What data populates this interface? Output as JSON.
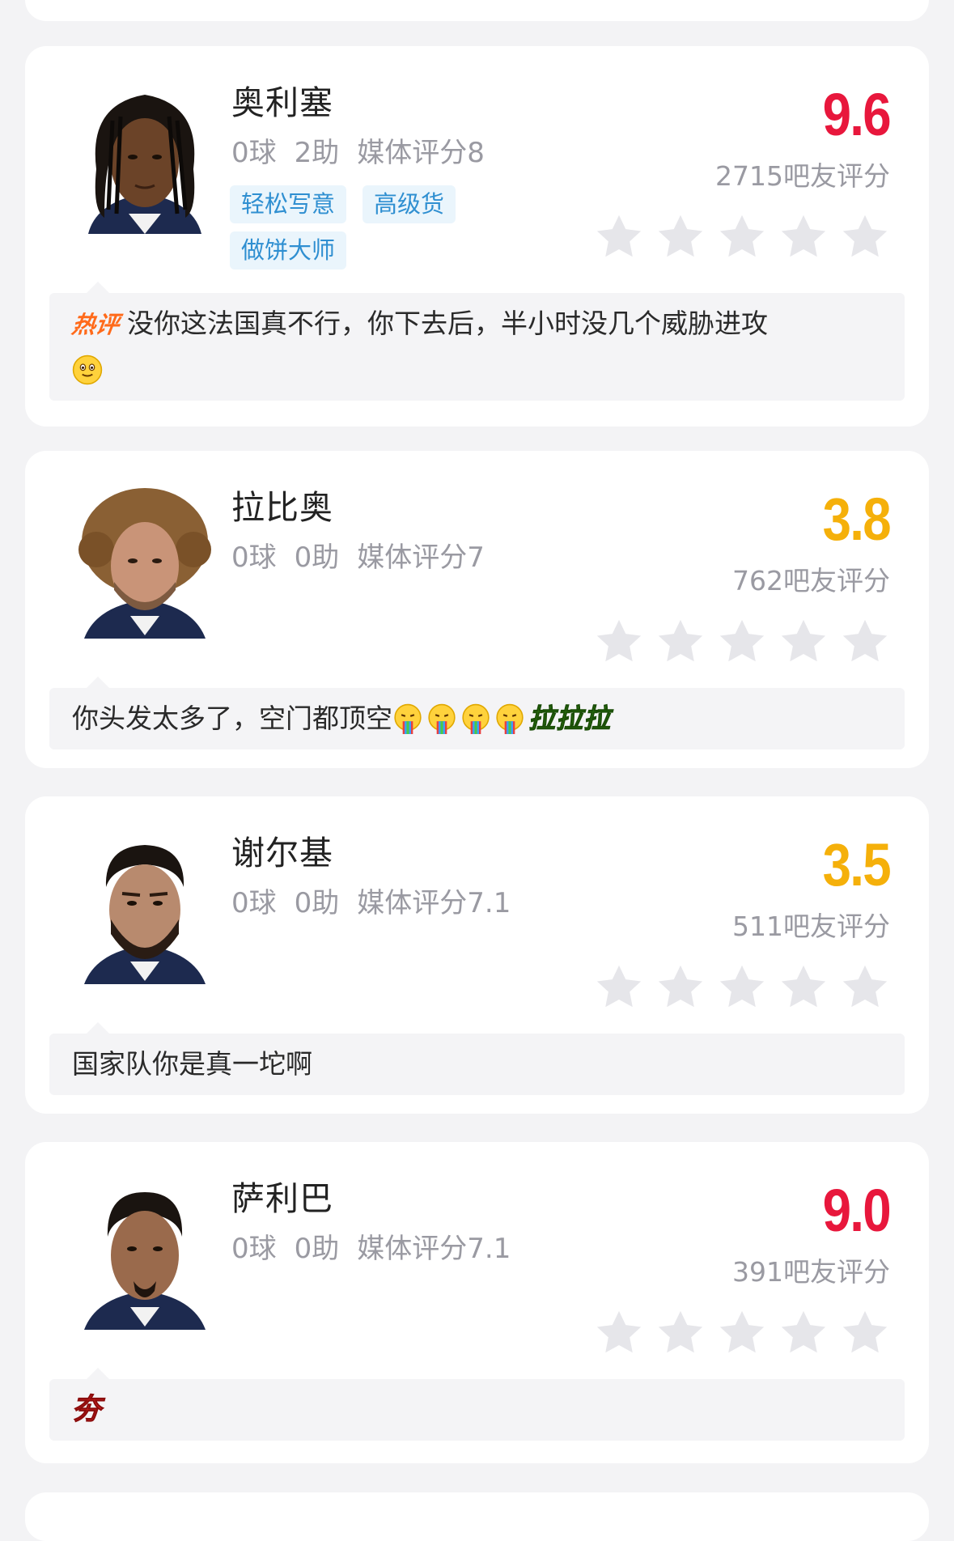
{
  "colors": {
    "score_high": "#e8173c",
    "score_low": "#f5b00a",
    "tag_bg": "#eaf5fc",
    "tag_text": "#2f8fd1",
    "star_empty": "#e6e6ea",
    "page_bg": "#f3f3f5"
  },
  "players": [
    {
      "name": "奥利塞",
      "goals": "0球",
      "assists": "2助",
      "media": "媒体评分8",
      "tags": [
        "轻松写意",
        "高级货",
        "做饼大师"
      ],
      "score": "9.6",
      "score_color": "red",
      "raters": "2715吧友评分",
      "stars_filled": 0,
      "comment": {
        "badge": "热评",
        "text": "没你这法国真不行，你下去后，半小时没几个威胁进攻",
        "emoji": "smile-emoji"
      }
    },
    {
      "name": "拉比奥",
      "goals": "0球",
      "assists": "0助",
      "media": "媒体评分7",
      "tags": [],
      "score": "3.8",
      "score_color": "gold",
      "raters": "762吧友评分",
      "stars_filled": 0,
      "comment": {
        "text": "你头发太多了，空门都顶空",
        "emoji": "rainbow-vomit-emoji",
        "emoji_count": 4,
        "sticker": "拉拉拉"
      }
    },
    {
      "name": "谢尔基",
      "goals": "0球",
      "assists": "0助",
      "media": "媒体评分7.1",
      "tags": [],
      "score": "3.5",
      "score_color": "gold",
      "raters": "511吧友评分",
      "stars_filled": 0,
      "comment": {
        "text": "国家队你是真一坨啊"
      }
    },
    {
      "name": "萨利巴",
      "goals": "0球",
      "assists": "0助",
      "media": "媒体评分7.1",
      "tags": [],
      "score": "9.0",
      "score_color": "red",
      "raters": "391吧友评分",
      "stars_filled": 0,
      "comment": {
        "sticker": "夯"
      }
    }
  ]
}
